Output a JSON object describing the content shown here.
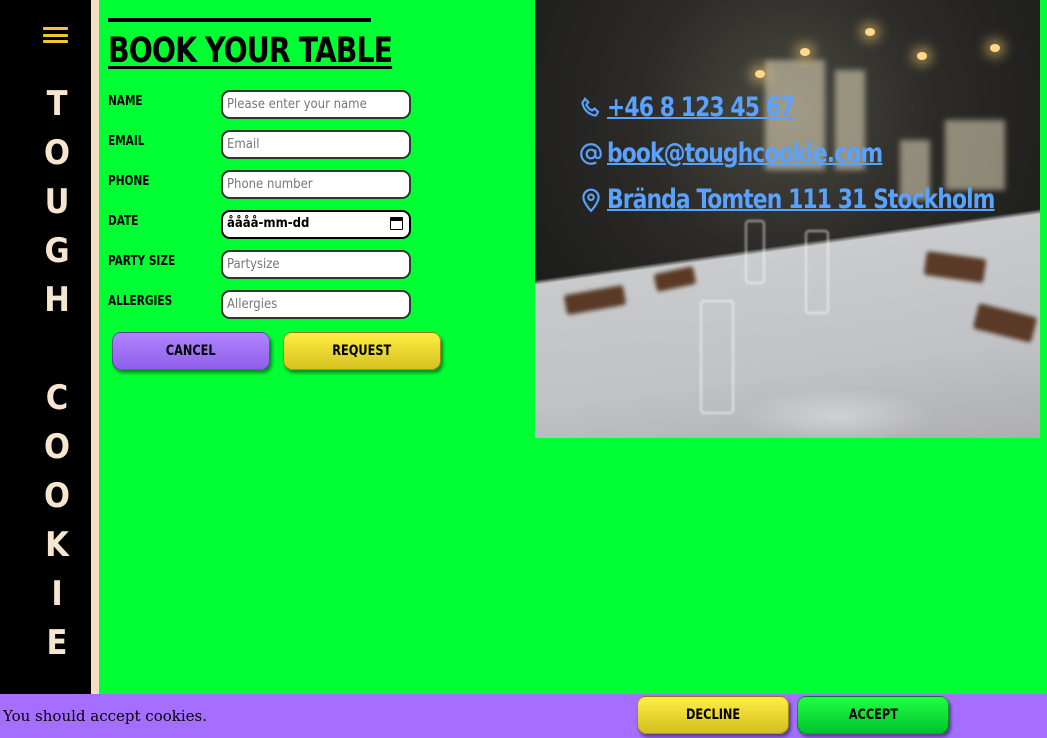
{
  "sidebar": {
    "brand_letters": [
      "T",
      "O",
      "U",
      "G",
      "H",
      " ",
      "C",
      "O",
      "O",
      "K",
      "I",
      "E"
    ],
    "menu_icon": "hamburger-icon"
  },
  "form": {
    "title": "BOOK YOUR TABLE",
    "fields": [
      {
        "label": "NAME",
        "placeholder": "Please enter your name"
      },
      {
        "label": "EMAIL",
        "placeholder": "Email"
      },
      {
        "label": "PHONE",
        "placeholder": "Phone number"
      },
      {
        "label": "DATE",
        "value": "åååå-mm-dd"
      },
      {
        "label": "PARTY SIZE",
        "placeholder": "Partysize"
      },
      {
        "label": "ALLERGIES",
        "placeholder": "Allergies"
      }
    ],
    "cancel_label": "CANCEL",
    "request_label": "REQUEST"
  },
  "contact": {
    "phone": "+46 8 123 45 67",
    "email": "book@toughcookie.com",
    "address": "Brända Tomten 111 31 Stockholm",
    "link_color": "#5aa2ff"
  },
  "cookie_banner": {
    "text": "You should accept cookies.",
    "decline_label": "DECLINE",
    "accept_label": "ACCEPT"
  },
  "colors": {
    "page_bg": "#00ff33",
    "sidebar_bg": "#000000",
    "brand_text": "#f6e6cf",
    "purple": "#a56eff",
    "yellow": "#f2e23a",
    "green": "#00e632"
  }
}
